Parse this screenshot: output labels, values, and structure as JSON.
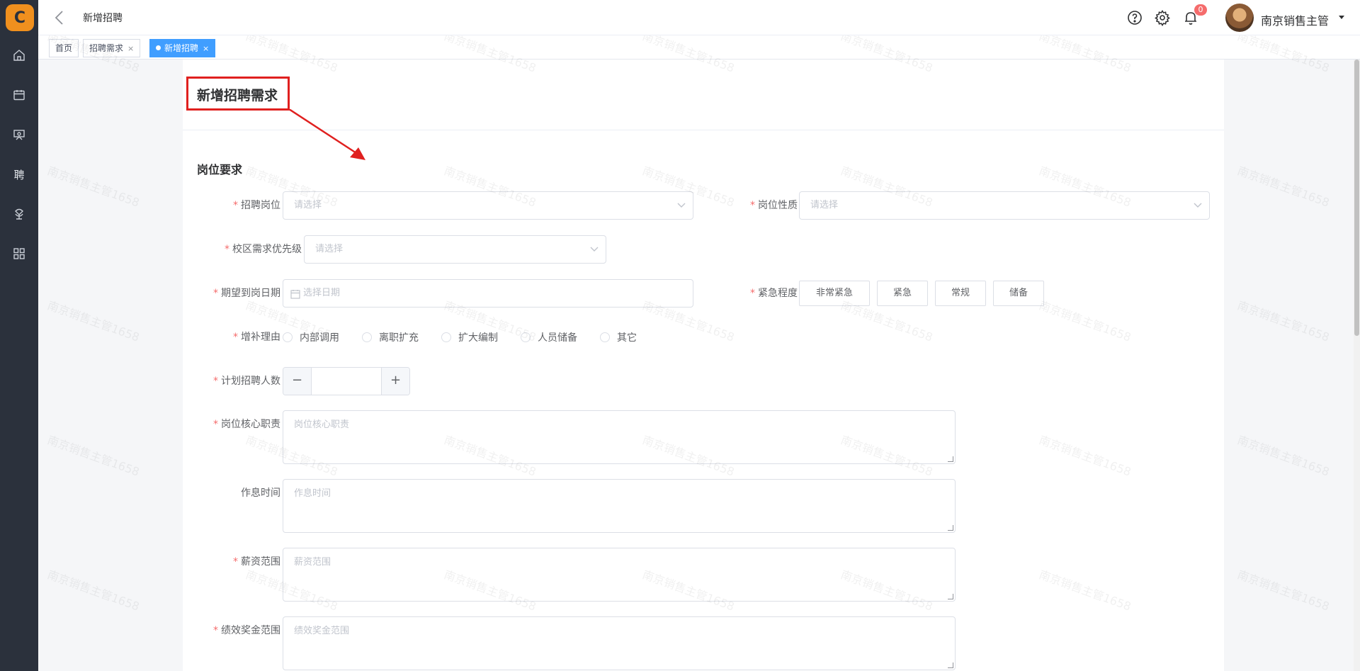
{
  "header": {
    "title": "新增招聘",
    "notification_count": "0",
    "user_name": "南京销售主管"
  },
  "sidebar": {
    "logo_text": "C",
    "items": [
      {
        "icon": "home-icon"
      },
      {
        "icon": "calendar-icon"
      },
      {
        "icon": "teacher-icon"
      },
      {
        "icon": "recruit-text",
        "label": "聘"
      },
      {
        "icon": "award-icon"
      },
      {
        "icon": "grid-icon"
      }
    ]
  },
  "tabs": [
    {
      "label": "首页"
    },
    {
      "label": "招聘需求",
      "close": "×"
    },
    {
      "label": "新增招聘",
      "close": "×",
      "active": true
    }
  ],
  "page": {
    "title": "新增招聘需求",
    "section_title": "岗位要求"
  },
  "form": {
    "position": {
      "label": "招聘岗位",
      "placeholder": "请选择"
    },
    "position_nature": {
      "label": "岗位性质",
      "placeholder": "请选择"
    },
    "campus_priority": {
      "label": "校区需求优先级",
      "placeholder": "请选择"
    },
    "expected_date": {
      "label": "期望到岗日期",
      "placeholder": "选择日期"
    },
    "urgency": {
      "label": "紧急程度",
      "options": [
        "非常紧急",
        "紧急",
        "常规",
        "储备"
      ]
    },
    "reason": {
      "label": "增补理由",
      "options": [
        "内部调用",
        "离职扩充",
        "扩大编制",
        "人员储备",
        "其它"
      ]
    },
    "headcount": {
      "label": "计划招聘人数",
      "minus": "−",
      "plus": "+",
      "value": ""
    },
    "core_duty": {
      "label": "岗位核心职责",
      "placeholder": "岗位核心职责"
    },
    "work_schedule": {
      "label": "作息时间",
      "placeholder": "作息时间"
    },
    "salary_range": {
      "label": "薪资范围",
      "placeholder": "薪资范围"
    },
    "bonus_range": {
      "label": "绩效奖金范围",
      "placeholder": "绩效奖金范围"
    }
  },
  "watermark": "南京销售主管1658",
  "colors": {
    "sidebar": "#2b313c",
    "accent": "#409eff",
    "required": "#f56c6c",
    "highlight": "#e0201f",
    "logo": "#f0901e"
  }
}
